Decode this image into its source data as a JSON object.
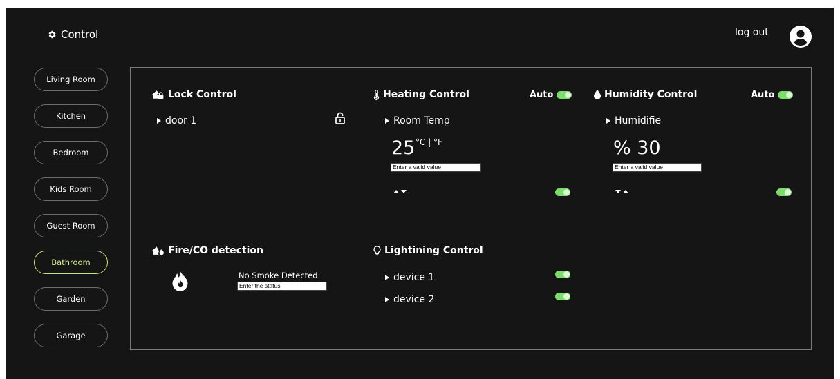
{
  "header": {
    "brand_label": "Control",
    "brand_icon": "gear-icon",
    "logout_label": "log out",
    "avatar_icon": "user-avatar-icon"
  },
  "sidebar": {
    "items": [
      {
        "label": "Living Room"
      },
      {
        "label": "Kitchen"
      },
      {
        "label": "Bedroom"
      },
      {
        "label": "Kids Room"
      },
      {
        "label": "Guest Room"
      },
      {
        "label": "Bathroom",
        "active": true
      },
      {
        "label": "Garden"
      },
      {
        "label": "Garage"
      }
    ],
    "active_color": "#c7e67a"
  },
  "lock": {
    "title": "Lock Control",
    "icon": "house-lock-icon",
    "device_label": "door 1",
    "state_icon": "unlocked-padlock-icon"
  },
  "heating": {
    "title": "Heating Control",
    "icon": "thermometer-icon",
    "auto_label": "Auto",
    "auto_on": true,
    "row_label": "Room Temp",
    "value": "25",
    "unit_label": "°C | °F",
    "input_placeholder": "Enter a valid value",
    "power_on": true
  },
  "humidity": {
    "title": "Humidity Control",
    "icon": "water-drop-icon",
    "auto_label": "Auto",
    "auto_on": true,
    "row_label": "Humidifie",
    "value": "% 30",
    "input_placeholder": "Enter a valid value",
    "power_on": true
  },
  "fire": {
    "title": "Fire/CO detection",
    "icon": "house-fire-icon",
    "status_label": "No Smoke Detected",
    "input_placeholder": "Enter the status",
    "status_icon": "fire-icon"
  },
  "lighting": {
    "title": "Lightining Control",
    "icon": "lightbulb-icon",
    "devices": [
      {
        "label": "device 1",
        "on": true
      },
      {
        "label": "device 2",
        "on": true
      }
    ]
  },
  "colors": {
    "background": "#151515",
    "toggle_on": "#7edc6e",
    "text": "#ffffff",
    "border": "#7a7a7a"
  }
}
